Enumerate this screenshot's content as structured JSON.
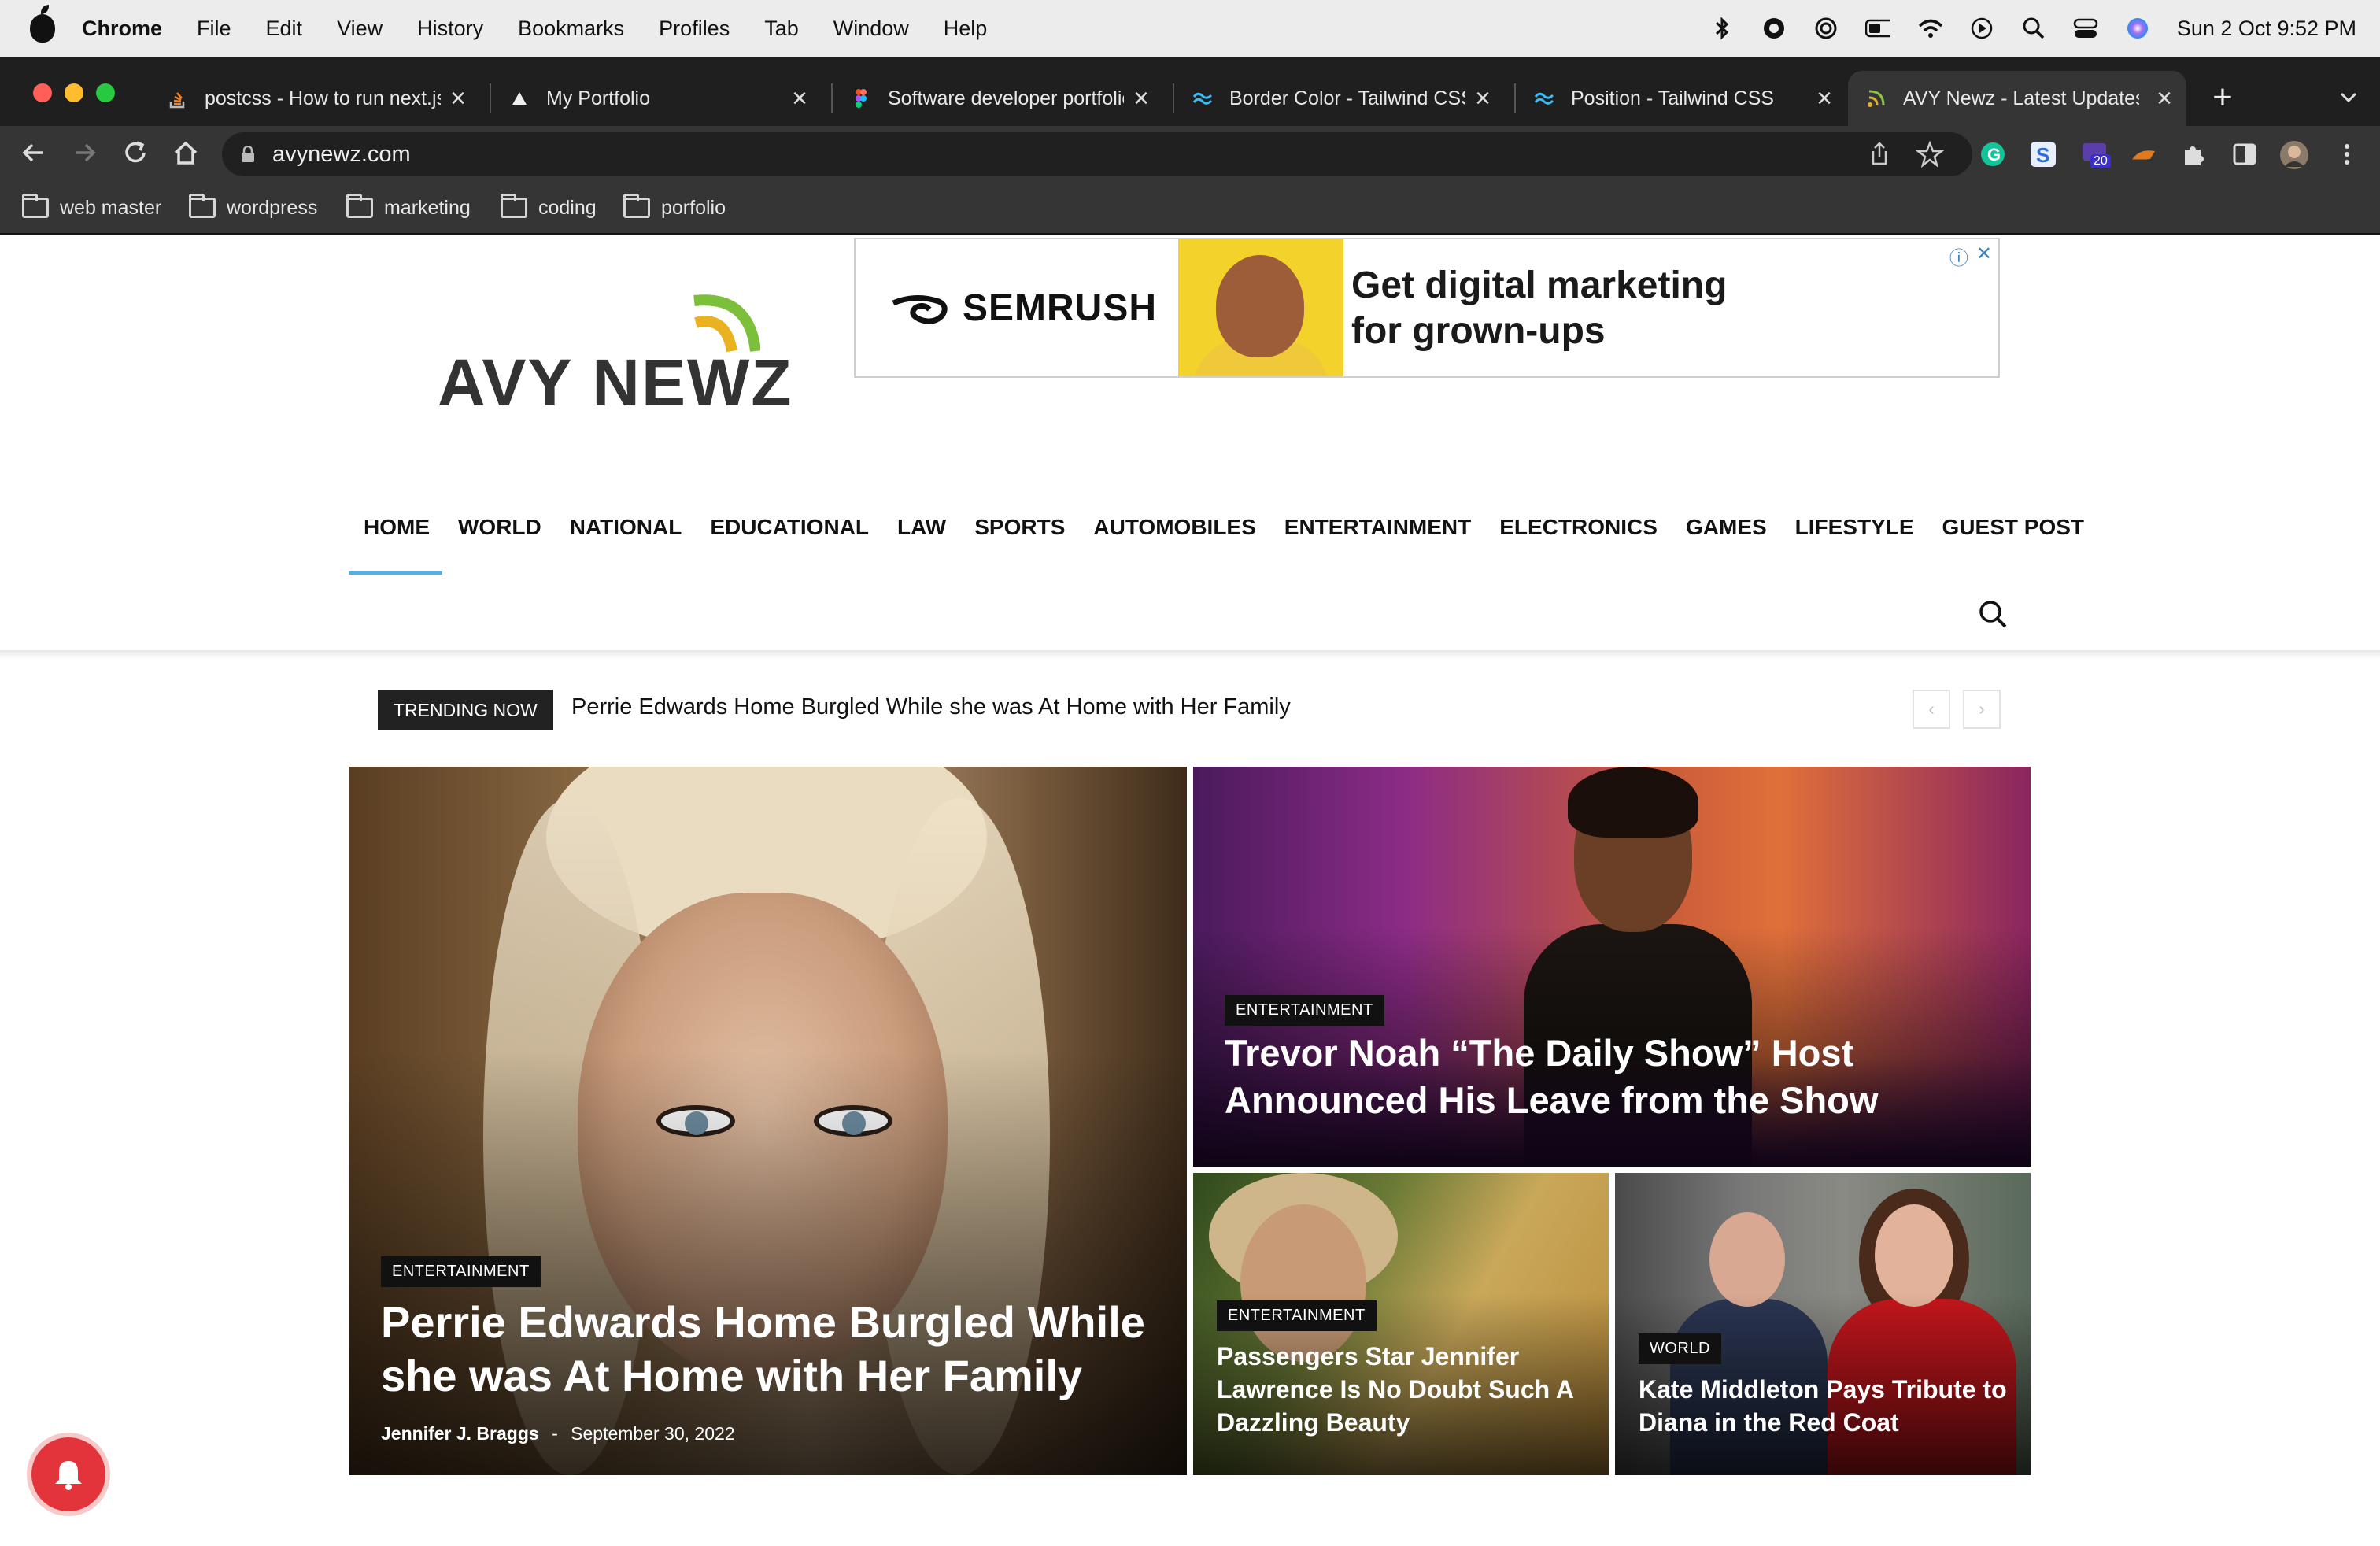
{
  "menubar": {
    "app": "Chrome",
    "items": [
      "File",
      "Edit",
      "View",
      "History",
      "Bookmarks",
      "Profiles",
      "Tab",
      "Window",
      "Help"
    ],
    "clock": "Sun 2 Oct  9:52 PM"
  },
  "tabs": [
    {
      "title": "postcss - How to run next.js"
    },
    {
      "title": "My Portfolio"
    },
    {
      "title": "Software developer portfolio"
    },
    {
      "title": "Border Color - Tailwind CSS"
    },
    {
      "title": "Position - Tailwind CSS"
    },
    {
      "title": "AVY Newz - Latest Updates"
    }
  ],
  "toolbar": {
    "url": "avynewz.com",
    "extension_badge": "20"
  },
  "bookmarks": [
    "web master",
    "wordpress",
    "marketing",
    "coding",
    "porfolio"
  ],
  "site": {
    "logo_text": "AVY NEWZ",
    "brand_color": "#4db2ec",
    "ad": {
      "brand": "SEMRUSH",
      "line1": "Get digital marketing",
      "line2": "for grown-ups"
    },
    "nav": [
      "HOME",
      "WORLD",
      "NATIONAL",
      "EDUCATIONAL",
      "LAW",
      "SPORTS",
      "AUTOMOBILES",
      "ENTERTAINMENT",
      "ELECTRONICS",
      "GAMES",
      "LIFESTYLE",
      "GUEST POST"
    ],
    "trending": {
      "label": "TRENDING NOW",
      "headline": "Perrie Edwards Home Burgled While she was At Home with Her Family",
      "prev_icon": "‹",
      "next_icon": "›"
    },
    "articles": {
      "hero": {
        "category": "ENTERTAINMENT",
        "line1": "Perrie Edwards Home Burgled While",
        "line2": "she was At Home with Her Family",
        "author": "Jennifer J. Braggs",
        "separator": "-",
        "date": "September 30, 2022"
      },
      "trevor": {
        "category": "ENTERTAINMENT",
        "line1": "Trevor Noah “The Daily Show” Host",
        "line2": "Announced His Leave from the Show"
      },
      "jennifer": {
        "category": "ENTERTAINMENT",
        "line1": "Passengers Star Jennifer",
        "line2": "Lawrence Is No Doubt Such A",
        "line3": "Dazzling Beauty"
      },
      "kate": {
        "category": "WORLD",
        "line1": "Kate Middleton Pays Tribute to",
        "line2": "Diana in the Red Coat"
      }
    }
  }
}
